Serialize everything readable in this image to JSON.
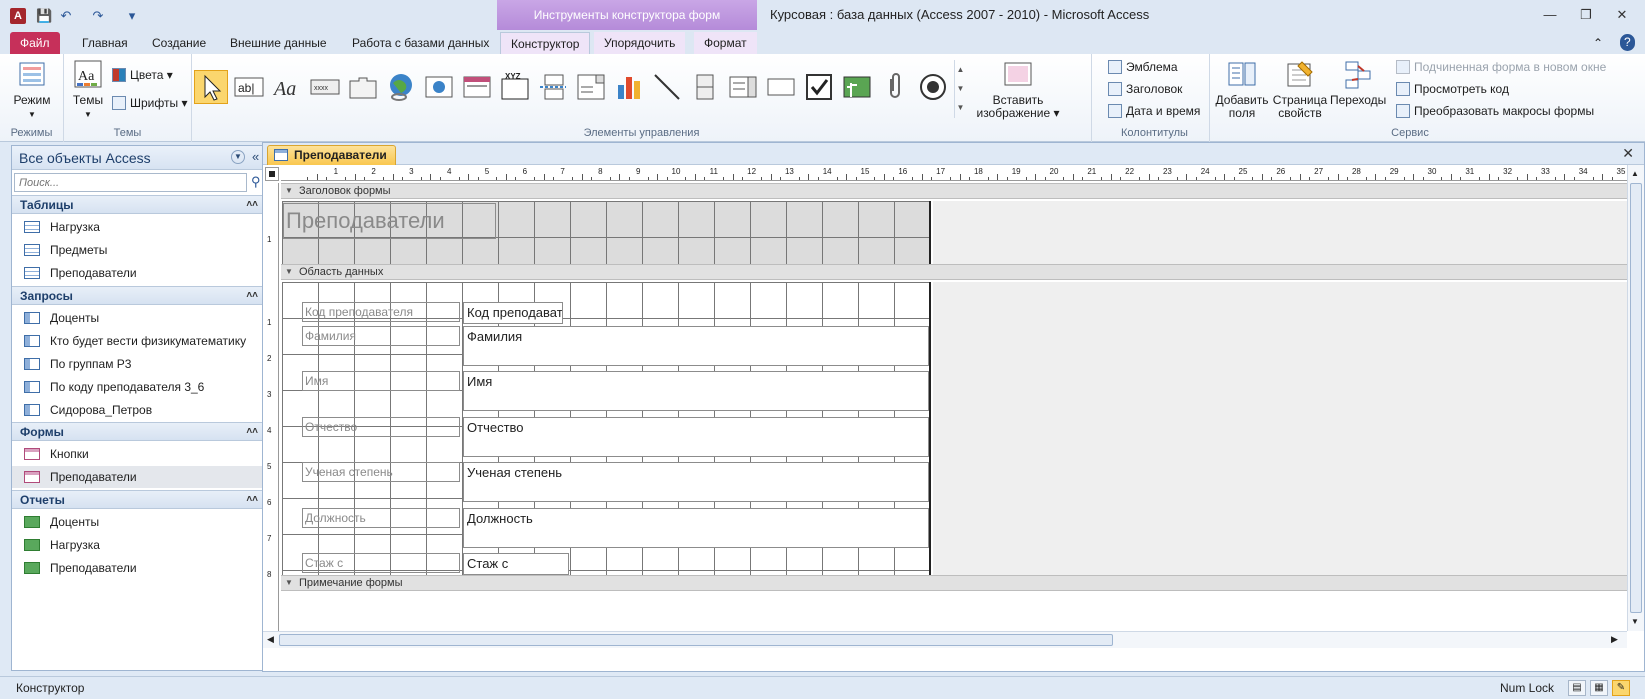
{
  "titlebar": {
    "context_tools": "Инструменты конструктора форм",
    "window_title": "Курсовая : база данных (Access 2007 - 2010)  -  Microsoft Access"
  },
  "tabs": {
    "file": "Файл",
    "home": "Главная",
    "create": "Создание",
    "external": "Внешние данные",
    "database_tools": "Работа с базами данных",
    "design": "Конструктор",
    "arrange": "Упорядочить",
    "format": "Формат"
  },
  "ribbon": {
    "views": {
      "view_label": "Режим",
      "group": "Режимы"
    },
    "themes": {
      "themes_label": "Темы",
      "colors_label": "Цвета",
      "fonts_label": "Шрифты",
      "group": "Темы"
    },
    "controls": {
      "group": "Элементы управления",
      "insert_image_label": "Вставить изображение"
    },
    "header_footer": {
      "logo": "Эмблема",
      "title": "Заголовок",
      "date_time": "Дата и время",
      "group": "Колонтитулы"
    },
    "tools": {
      "add_fields": "Добавить поля",
      "property_sheet": "Страница свойств",
      "tab_order": "Переходы",
      "subform_new_window": "Подчиненная форма в новом окне",
      "view_code": "Просмотреть код",
      "convert_macros": "Преобразовать макросы формы",
      "group": "Сервис"
    }
  },
  "nav": {
    "title": "Все объекты Access",
    "search_placeholder": "Поиск...",
    "categories": [
      {
        "label": "Таблицы",
        "items": [
          "Нагрузка",
          "Предметы",
          "Преподаватели"
        ]
      },
      {
        "label": "Запросы",
        "items": [
          "Доценты",
          "Кто будет вести физикуматематику",
          "По группам Р3",
          "По коду преподавателя 3_6",
          "Сидорова_Петров"
        ]
      },
      {
        "label": "Формы",
        "items": [
          "Кнопки",
          "Преподаватели"
        ]
      },
      {
        "label": "Отчеты",
        "items": [
          "Доценты",
          "Нагрузка",
          "Преподаватели"
        ]
      }
    ]
  },
  "document": {
    "tab_label": "Преподаватели",
    "sections": {
      "form_header": "Заголовок формы",
      "detail": "Область данных",
      "form_footer": "Примечание формы"
    },
    "header_title": "Преподаватели",
    "fields": [
      {
        "label": "Код преподавателя",
        "value": "Код преподават"
      },
      {
        "label": "Фамилия",
        "value": "Фамилия"
      },
      {
        "label": "Имя",
        "value": "Имя"
      },
      {
        "label": "Отчество",
        "value": "Отчество"
      },
      {
        "label": "Ученая степень",
        "value": "Ученая степень"
      },
      {
        "label": "Должность",
        "value": "Должность"
      },
      {
        "label": "Стаж с",
        "value": "Стаж с"
      }
    ]
  },
  "status": {
    "mode": "Конструктор",
    "numlock": "Num Lock"
  },
  "colors": {
    "file_tab": "#c6305a",
    "context_header": "#b58bd9",
    "selected_tab": "#f9c74f"
  }
}
